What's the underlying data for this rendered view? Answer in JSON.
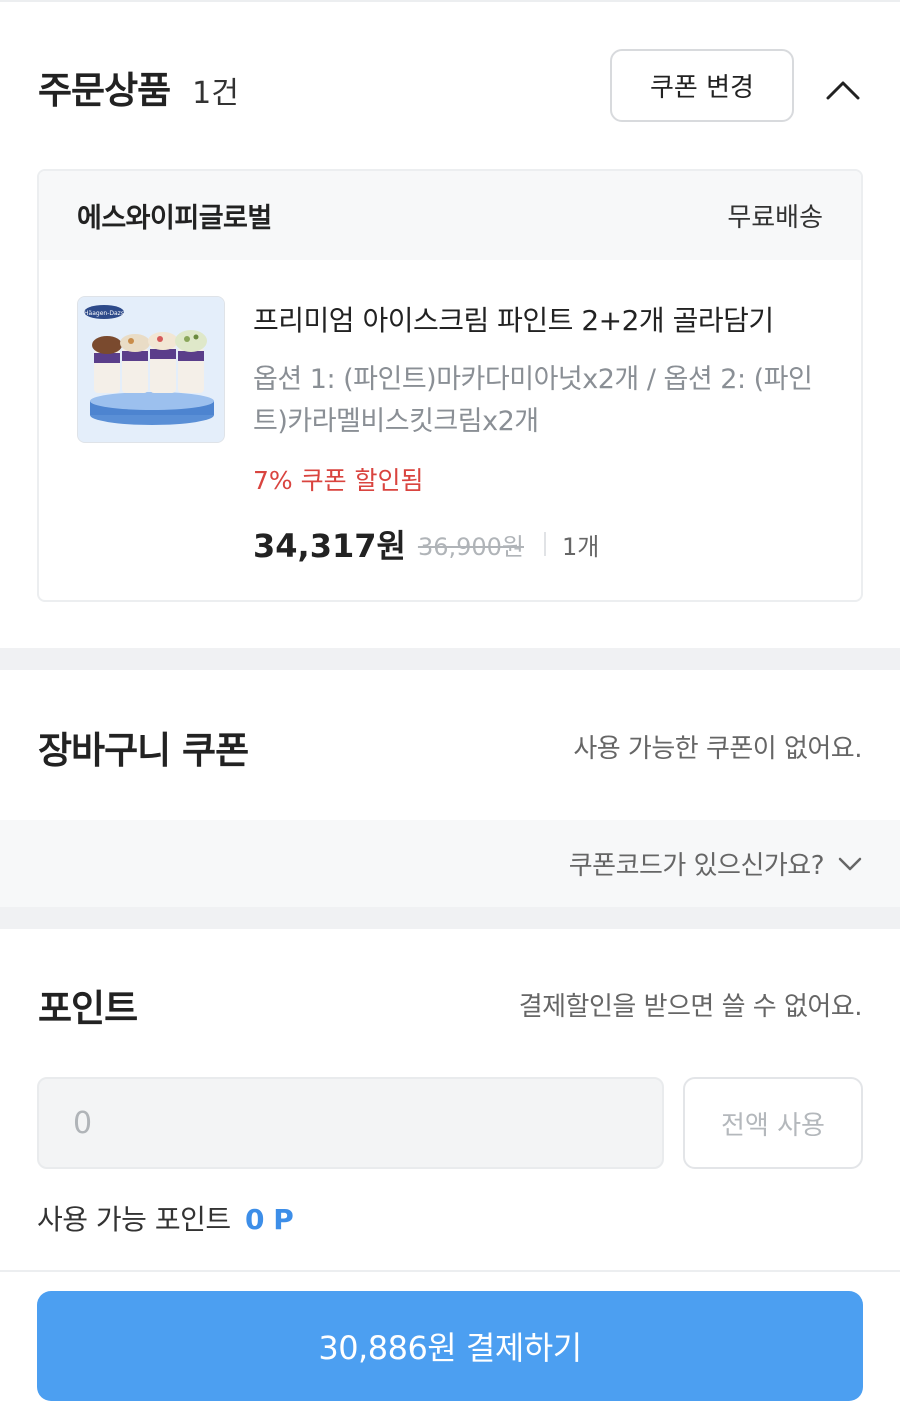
{
  "order": {
    "title": "주문상품",
    "count": "1건",
    "coupon_change_label": "쿠폰 변경",
    "collapse_icon": "chevron-up-icon"
  },
  "card": {
    "seller": "에스와이피글로벌",
    "shipping": "무료배송",
    "product_name": "프리미엄 아이스크림 파인트 2+2개 골라담기",
    "option": "옵션 1: (파인트)마카다미아넛x2개 / 옵션 2: (파인트)카라멜비스킷크림x2개",
    "discount": "7% 쿠폰 할인됨",
    "price": "34,317원",
    "original_price": "36,900원",
    "quantity": "1개",
    "thumb_brand": "Häagen-Dazs"
  },
  "cart_coupon": {
    "title": "장바구니 쿠폰",
    "note": "사용 가능한 쿠폰이 없어요.",
    "code_prompt": "쿠폰코드가 있으신가요?"
  },
  "points": {
    "title": "포인트",
    "note": "결제할인을 받으면 쓸 수 없어요.",
    "input_value": "0",
    "use_all_label": "전액 사용",
    "available_label": "사용 가능 포인트",
    "available_value": "0 P"
  },
  "pay": {
    "label": "30,886원 결제하기"
  },
  "colors": {
    "accent": "#4c9ff1",
    "discount": "#d9443f",
    "points_value": "#3d8ee8"
  }
}
